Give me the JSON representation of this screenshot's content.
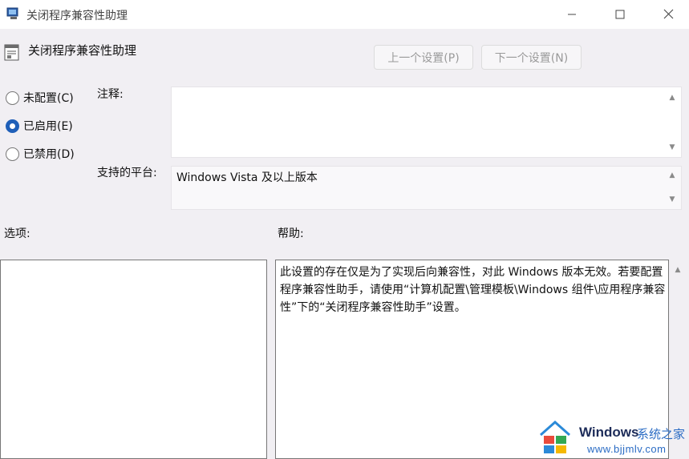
{
  "window": {
    "title": "关闭程序兼容性助理",
    "controls": {
      "minimize": "minimize-icon",
      "maximize": "maximize-icon",
      "close": "close-icon"
    }
  },
  "policy": {
    "title": "关闭程序兼容性助理",
    "prev_label": "上一个设置(P)",
    "next_label": "下一个设置(N)"
  },
  "state": {
    "options": [
      {
        "label": "未配置(C)",
        "checked": false
      },
      {
        "label": "已启用(E)",
        "checked": true
      },
      {
        "label": "已禁用(D)",
        "checked": false
      }
    ]
  },
  "comment": {
    "label": "注释:",
    "value": ""
  },
  "platform": {
    "label": "支持的平台:",
    "value": "Windows Vista 及以上版本"
  },
  "options_panel": {
    "label": "选项:"
  },
  "help_panel": {
    "label": "帮助:",
    "text": "此设置的存在仅是为了实现后向兼容性，对此 Windows 版本无效。若要配置程序兼容性助手，请使用“计算机配置\\管理模板\\Windows 组件\\应用程序兼容性”下的“关闭程序兼容性助手”设置。"
  },
  "watermark": {
    "brand": "Windows",
    "tagline": "系统之家",
    "url": "www.bjjmlv.com"
  },
  "colors": {
    "accent": "#1f5fb8",
    "background": "#f1eff3"
  }
}
